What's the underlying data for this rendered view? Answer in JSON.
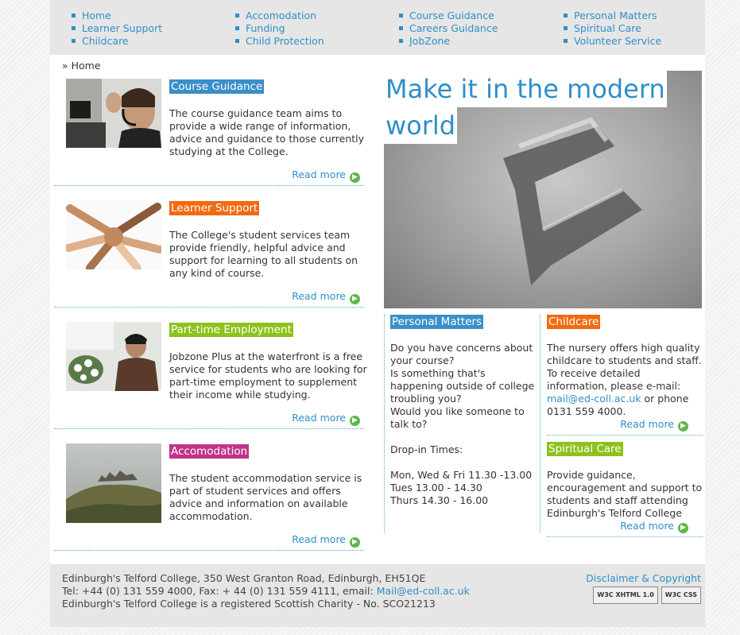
{
  "nav": {
    "col1": [
      "Home",
      "Learner Support",
      "Childcare"
    ],
    "col2": [
      "Accomodation",
      "Funding",
      "Child Protection"
    ],
    "col3": [
      "Course Guidance",
      "Careers Guidance",
      "JobZone"
    ],
    "col4": [
      "Personal Matters",
      "Spiritual Care",
      "Volunteer Service"
    ]
  },
  "breadcrumb": "» Home",
  "items": [
    {
      "title": "Course Guidance",
      "color": "#3a8fc8",
      "text": "The course guidance team aims to provide a wide range of information, advice and guidance to those currently studying at the College.",
      "more": "Read more"
    },
    {
      "title": "Learner Support",
      "color": "#f26a10",
      "text": "The College's student services team provide friendly, helpful advice and support for learning to all students on any kind of course.",
      "more": "Read more"
    },
    {
      "title": "Part-time Employment",
      "color": "#8cc21c",
      "text": "Jobzone Plus at the waterfront is a free service for students who are looking for part-time employment to supplement their income while studying.",
      "more": "Read more"
    },
    {
      "title": "Accomodation",
      "color": "#c2338a",
      "text": "The student accommodation service is part of student services and offers advice and information on available accommodation.",
      "more": "Read more"
    }
  ],
  "hero": {
    "line1": "Make it in the modern",
    "line2": "world"
  },
  "personal": {
    "title": "Personal Matters",
    "color": "#3a8fc8",
    "lines": [
      "Do you have concerns about your course?",
      "Is something that's happening outside of college troubling you?",
      "Would you like someone to talk to?",
      "",
      "Drop-in Times:",
      "",
      "Mon, Wed & Fri 11.30 -13.00",
      "Tues 13.00 - 14.30",
      "Thurs 14.30 - 16.00"
    ]
  },
  "childcare": {
    "title": "Childcare",
    "color": "#f26a10",
    "text_before": "The nursery offers high quality childcare to students and staff. To receive detailed information, please e-mail:",
    "email": "mail@ed-coll.ac.uk",
    "text_after": " or phone 0131 559 4000.",
    "more": "Read more"
  },
  "spiritual": {
    "title": "Spiritual Care",
    "color": "#8cc21c",
    "text": "Provide guidance, encouragement and support to students and staff attending Edinburgh's Telford College",
    "more": "Read more"
  },
  "footer": {
    "address": "Edinburgh's Telford College, 350 West Granton Road, Edinburgh, EH51QE",
    "contact_prefix": "Tel: +44 (0) 131 559 4000, Fax: + 44 (0) 131 559 4111, email: ",
    "contact_email": "Mail@ed-coll.ac.uk",
    "charity": "Edinburgh's Telford College is a registered Scottish Charity - No. SCO21213",
    "disclaimer": "Disclaimer & Copyright",
    "badge1": "W3C XHTML 1.0",
    "badge2": "W3C CSS"
  }
}
